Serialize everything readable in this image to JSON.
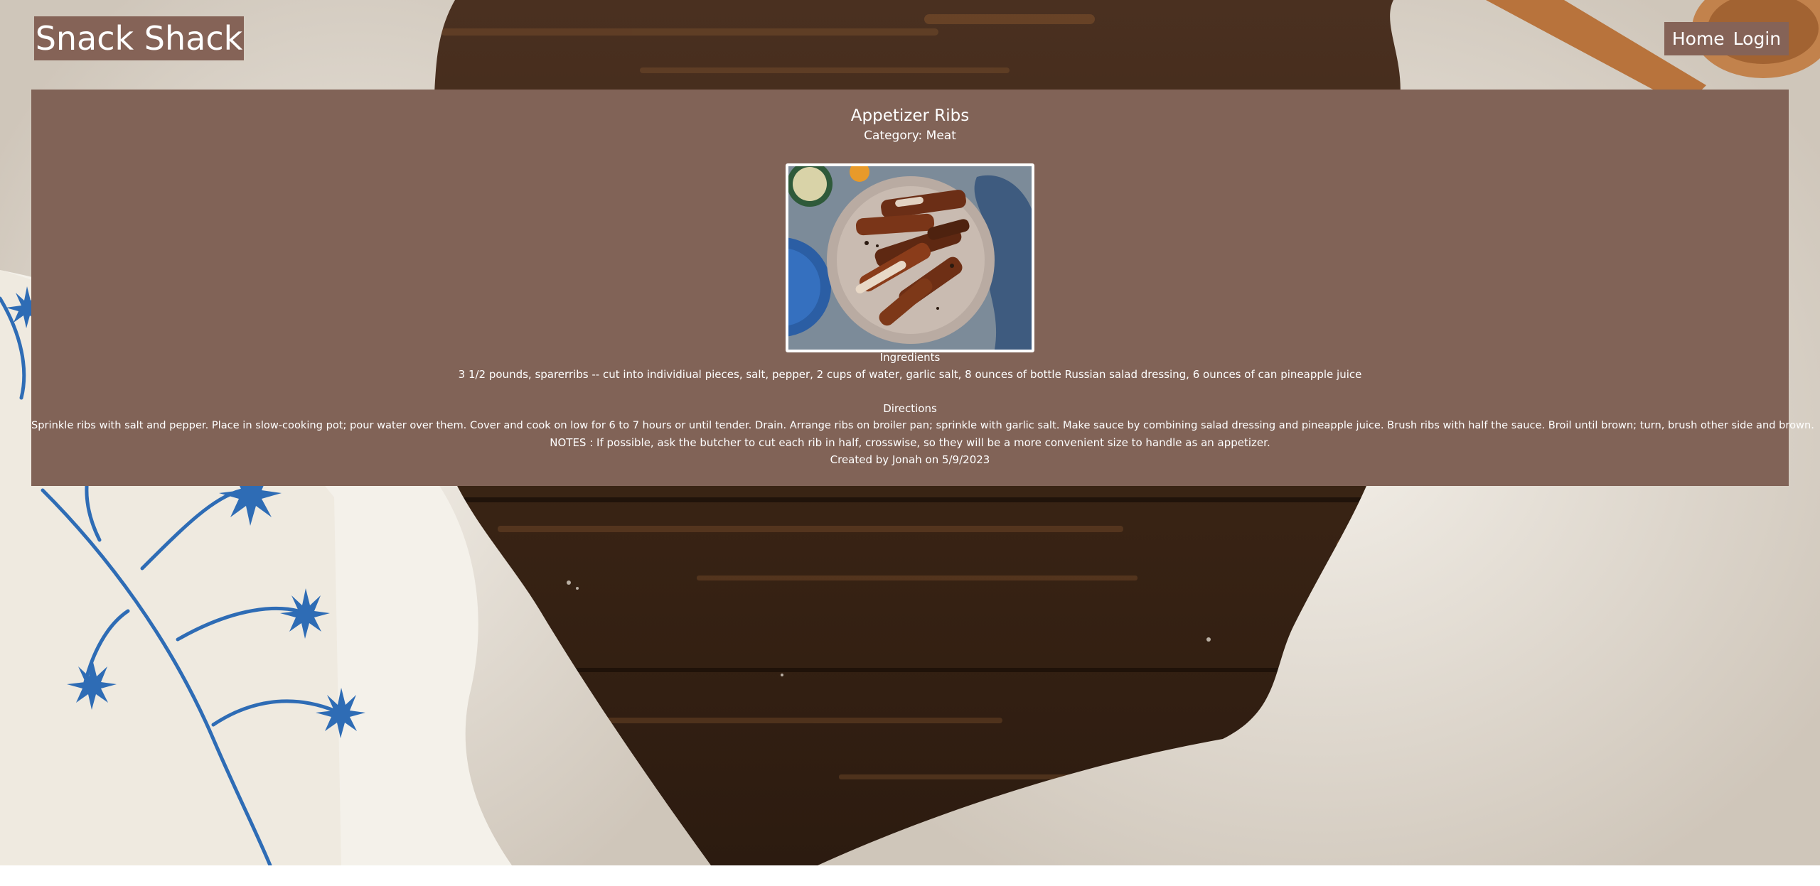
{
  "header": {
    "brand": "Snack Shack",
    "nav": [
      {
        "label": "Home"
      },
      {
        "label": "Login"
      }
    ]
  },
  "recipe": {
    "title": "Appetizer Ribs",
    "category": "Category: Meat",
    "ingredients_heading": "Ingredients",
    "ingredients": "3 1/2 pounds, sparerribs -- cut into individiual pieces, salt, pepper, 2 cups of water, garlic salt, 8 ounces of bottle Russian salad dressing, 6 ounces of can pineapple juice",
    "directions_heading": "Directions",
    "directions": "Sprinkle ribs with salt and pepper. Place in slow-cooking pot; pour water over them. Cover and cook on low for 6 to 7 hours or until tender. Drain. Arrange ribs on broiler pan; sprinkle with garlic salt. Make sauce by combining salad dressing and pineapple juice. Brush ribs with half the sauce. Broil until brown; turn, brush other side and brown.",
    "notes": "NOTES : If possible, ask the butcher to cut each rib in half, crosswise, so they will be a more convenient size to handle as an appetizer.",
    "created": "Created by Jonah on 5/9/2023"
  },
  "colors": {
    "panel": "#816357",
    "text": "#ffffff",
    "wood": "#3a2516",
    "flour": "#e8e2d8"
  }
}
